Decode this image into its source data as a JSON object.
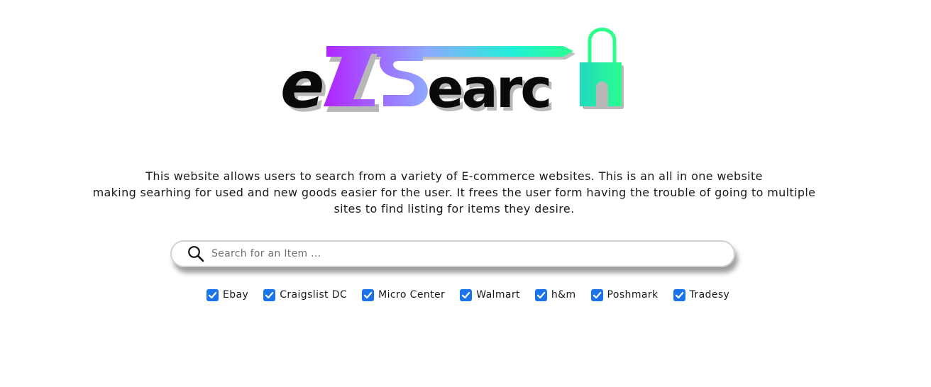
{
  "logo": {
    "text": "eZSearch",
    "colors": {
      "dark": "#0a0a0a",
      "gradient_start": "#b026ff",
      "gradient_mid": "#8fa8ff",
      "gradient_end": "#2bff8c",
      "shadow": "#b8b8b8"
    },
    "icon": "shopping-bag-icon"
  },
  "description": {
    "lines": [
      "This website allows users to search from a variety of E-commerce websites. This is an all in one website",
      "making searhing for used and new goods easier for the user. It frees the user form having the trouble of going to multiple",
      "sites to find listing for items they desire."
    ]
  },
  "search": {
    "placeholder": "Search for an Item ...",
    "value": "",
    "icon": "search-icon"
  },
  "sites": [
    {
      "label": "Ebay",
      "checked": true
    },
    {
      "label": "Craigslist DC",
      "checked": true
    },
    {
      "label": "Micro Center",
      "checked": true
    },
    {
      "label": "Walmart",
      "checked": true
    },
    {
      "label": "h&m",
      "checked": true
    },
    {
      "label": "Poshmark",
      "checked": true
    },
    {
      "label": "Tradesy",
      "checked": true
    }
  ],
  "colors": {
    "checkbox": "#1a73e8",
    "text": "#1a1a1a",
    "search_border": "#d2d2d2"
  }
}
